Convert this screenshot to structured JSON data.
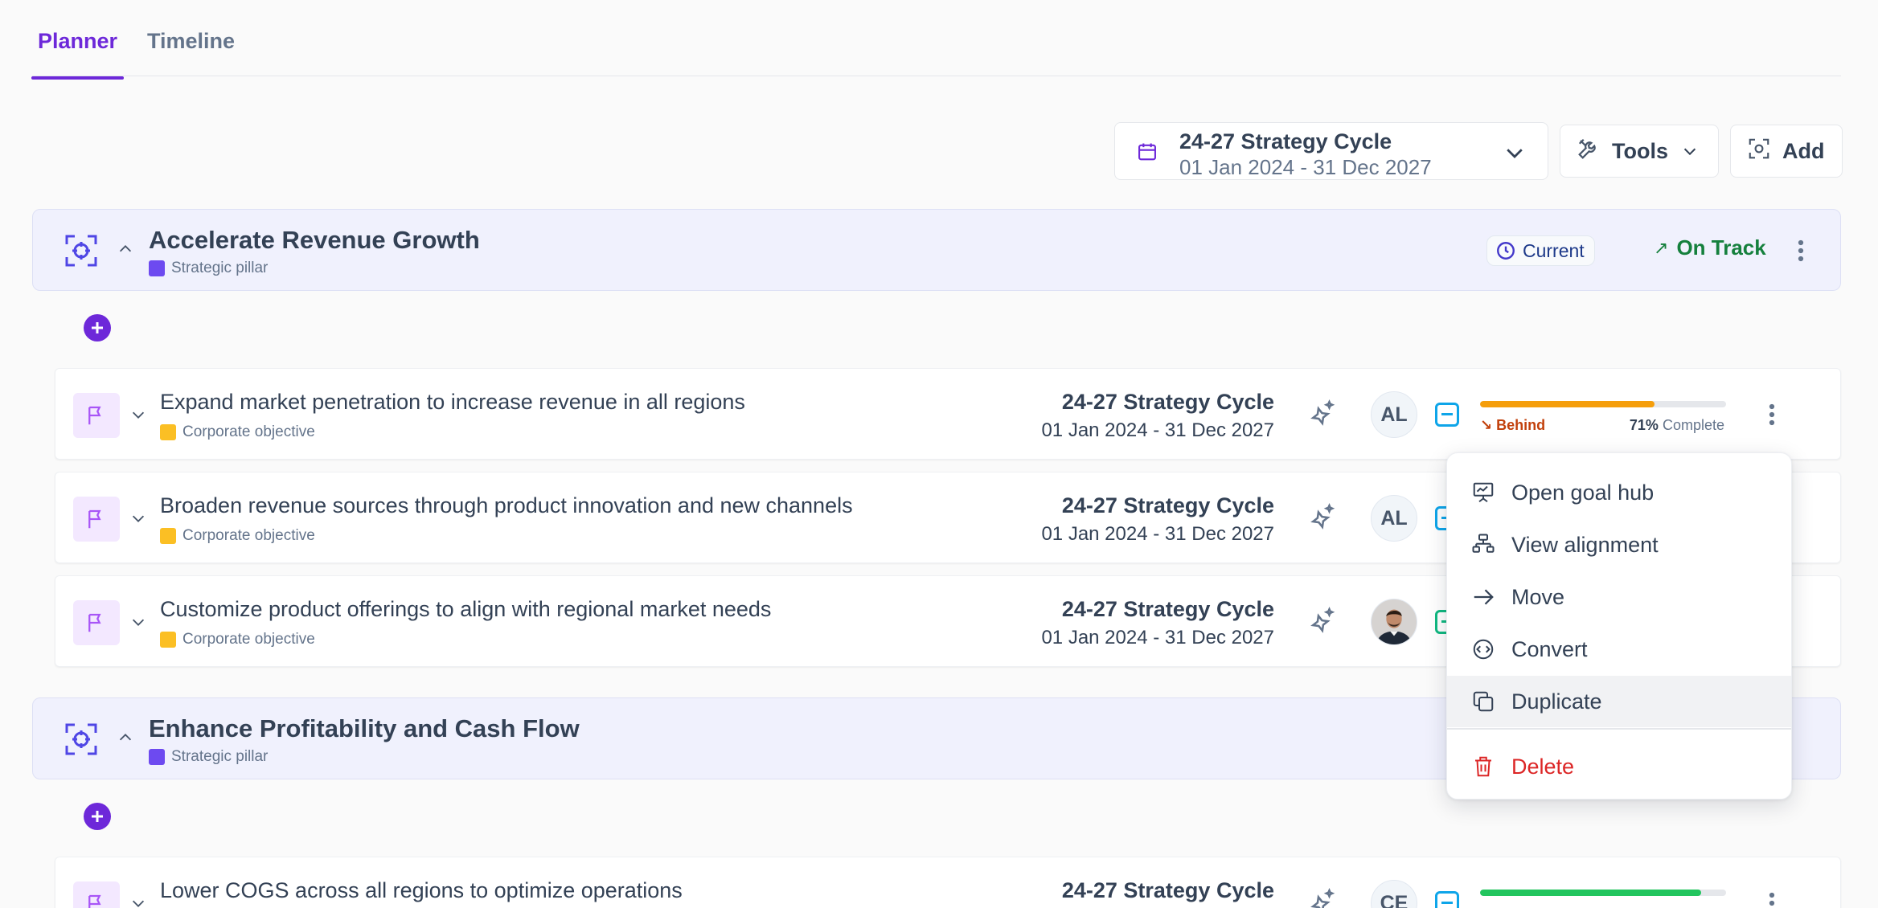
{
  "tabs": [
    {
      "label": "Planner",
      "active": true
    },
    {
      "label": "Timeline",
      "active": false
    }
  ],
  "toolbar": {
    "cycle_name": "24-27 Strategy Cycle",
    "cycle_dates": "01 Jan 2024 - 31 Dec 2027",
    "tools_label": "Tools",
    "add_label": "Add"
  },
  "colors": {
    "accent": "#6d28d9",
    "pillar_square": "#6d4af0",
    "objective_square": "#fbbf24",
    "behind_orange": "#f59e0b",
    "progress_green": "#22c55e",
    "on_track": "#15803d",
    "delete_red": "#dc2626"
  },
  "pillars": [
    {
      "title": "Accelerate Revenue Growth",
      "type": "Strategic pillar",
      "period_badge": "Current",
      "status": "On Track"
    },
    {
      "title": "Enhance Profitability and Cash Flow",
      "type": "Strategic pillar"
    }
  ],
  "objectives": [
    {
      "title": "Expand market penetration to increase revenue in all regions",
      "type": "Corporate objective",
      "cycle": "24-27 Strategy Cycle",
      "dates": "01 Jan 2024 - 31 Dec 2027",
      "owner_initials": "AL",
      "progress": 0.71,
      "progress_status": "Behind",
      "progress_pct": "71%",
      "progress_suffix": "Complete"
    },
    {
      "title": "Broaden revenue sources through product innovation and new channels",
      "type": "Corporate objective",
      "cycle": "24-27 Strategy Cycle",
      "dates": "01 Jan 2024 - 31 Dec 2027",
      "owner_initials": "AL"
    },
    {
      "title": "Customize product offerings to align with regional market needs",
      "type": "Corporate objective",
      "cycle": "24-27 Strategy Cycle",
      "dates": "01 Jan 2024 - 31 Dec 2027",
      "owner_avatar": "user-photo-avatar"
    },
    {
      "title": "Lower COGS across all regions to optimize operations",
      "cycle": "24-27 Strategy Cycle",
      "owner_initials": "CE",
      "progress": 0.9
    }
  ],
  "context_menu": {
    "items": [
      {
        "label": "Open goal hub",
        "icon": "presentation-chart-icon"
      },
      {
        "label": "View alignment",
        "icon": "hierarchy-icon"
      },
      {
        "label": "Move",
        "icon": "arrow-right-icon"
      },
      {
        "label": "Convert",
        "icon": "convert-icon"
      },
      {
        "label": "Duplicate",
        "icon": "copy-icon",
        "highlighted": true
      },
      {
        "label": "Delete",
        "icon": "trash-icon",
        "destructive": true
      }
    ]
  }
}
